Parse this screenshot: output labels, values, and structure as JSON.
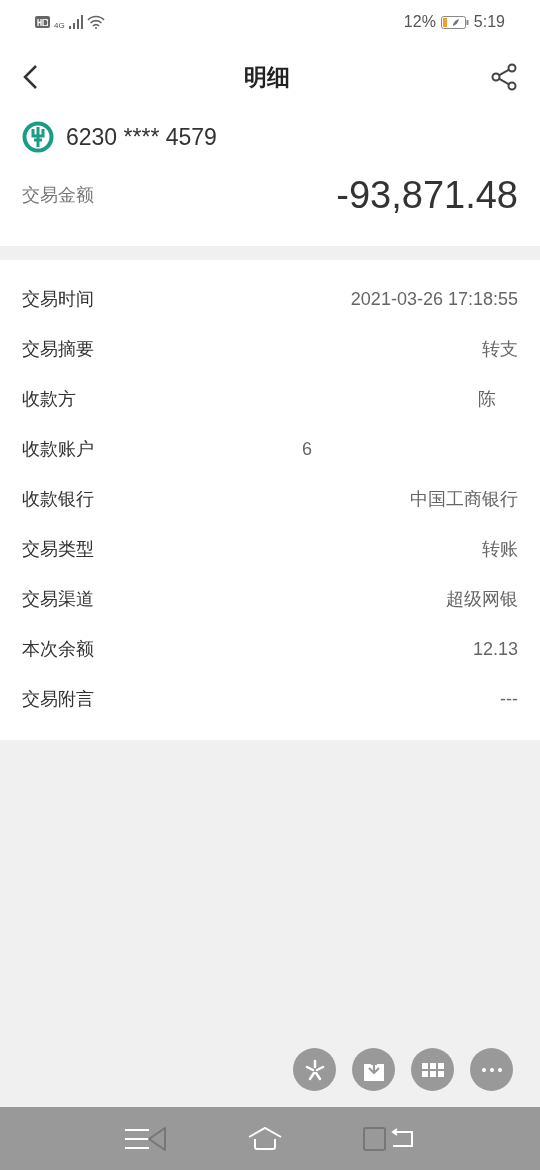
{
  "status_bar": {
    "network": "4G",
    "battery_text": "12%",
    "time": "5:19"
  },
  "header": {
    "title": "明细"
  },
  "account": {
    "number": "6230 **** 4579",
    "amount_label": "交易金额",
    "amount": "-93,871.48"
  },
  "details": [
    {
      "label": "交易时间",
      "value": "2021-03-26 17:18:55",
      "kind": "plain"
    },
    {
      "label": "交易摘要",
      "value": "转支",
      "kind": "plain"
    },
    {
      "label": "收款方",
      "value": "陈",
      "kind": "masked_end"
    },
    {
      "label": "收款账户",
      "value": "6",
      "kind": "masked_start"
    },
    {
      "label": "收款银行",
      "value": "中国工商银行",
      "kind": "plain"
    },
    {
      "label": "交易类型",
      "value": "转账",
      "kind": "plain"
    },
    {
      "label": "交易渠道",
      "value": "超级网银",
      "kind": "plain"
    },
    {
      "label": "本次余额",
      "value": "12.13",
      "kind": "plain"
    },
    {
      "label": "交易附言",
      "value": "---",
      "kind": "plain"
    }
  ]
}
